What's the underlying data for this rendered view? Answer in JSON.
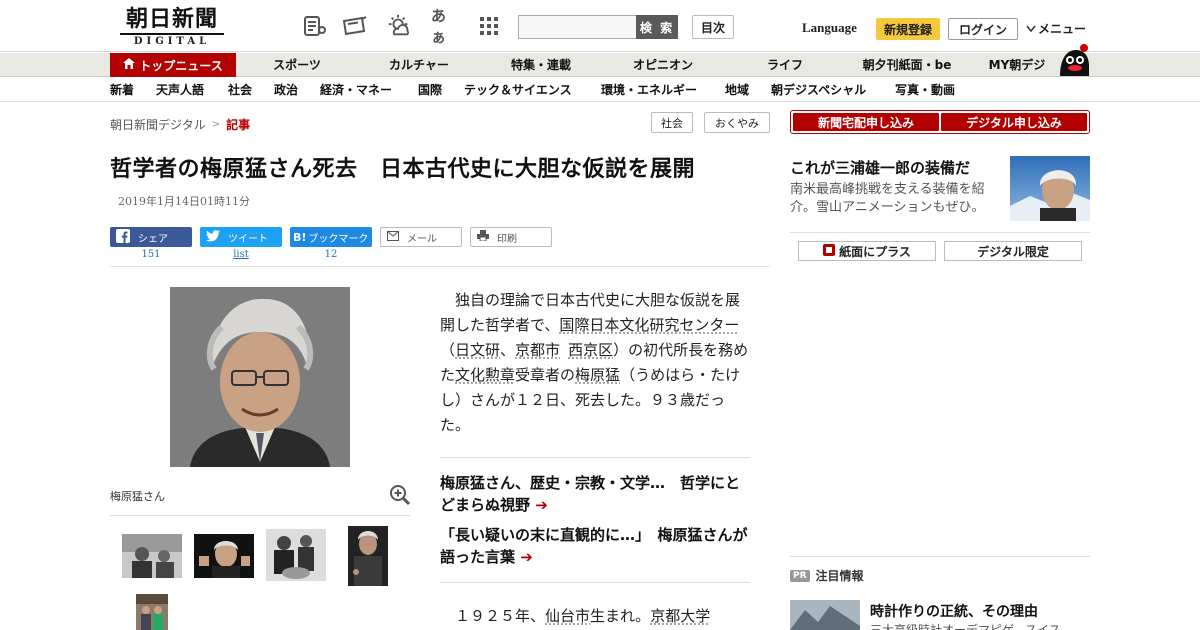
{
  "header": {
    "logo_text": "朝日新聞",
    "logo_sub": "DIGITAL",
    "search_button": "検 索",
    "toc_button": "目次",
    "language": "Language",
    "signup": "新規登録",
    "login": "ログイン",
    "menu": "メニュー",
    "font_size_icon_text": "あぁ"
  },
  "mainnav": {
    "top_news": "トップニュース",
    "items": [
      "スポーツ",
      "カルチャー",
      "特集・連載",
      "オピニオン",
      "ライフ",
      "朝夕刊紙面・be",
      "MY朝デジ"
    ]
  },
  "subnav": {
    "items": [
      "新着",
      "天声人語",
      "社会",
      "政治",
      "経済・マネー",
      "国際",
      "テック＆サイエンス",
      "環境・エネルギー",
      "地域",
      "朝デジスペシャル",
      "写真・動画"
    ]
  },
  "breadcrumb": {
    "home": "朝日新聞デジタル",
    "sep": ">",
    "current": "記事"
  },
  "tags": [
    "社会",
    "おくやみ"
  ],
  "article": {
    "title": "哲学者の梅原猛さん死去　日本古代史に大胆な仮説を展開",
    "date": "2019年1月14日01時11分",
    "photo_caption": "梅原猛さん",
    "body_parts": [
      {
        "t": "　独自の理論で日本古代史に大胆な仮説を展開した哲学者で、",
        "u": false
      },
      {
        "t": "国際日本文化研究センター",
        "u": true
      },
      {
        "t": "（",
        "u": false
      },
      {
        "t": "日文研",
        "u": true
      },
      {
        "t": "、",
        "u": false
      },
      {
        "t": "京都市",
        "u": true
      },
      {
        "t": "西京区",
        "u": true
      },
      {
        "t": "）の初代所長を務めた",
        "u": false
      },
      {
        "t": "文化勲章",
        "u": true
      },
      {
        "t": "受章者の",
        "u": false
      },
      {
        "t": "梅原猛",
        "u": true
      },
      {
        "t": "（うめはら・たけし）さんが１２日、死去した。９３歳だった。",
        "u": false
      }
    ],
    "related": [
      "梅原猛さん、歴史・宗教・文学…　哲学にとどまらぬ視野",
      "「長い疑いの末に直観的に…」　梅原猛さんが語った言葉"
    ],
    "body2_parts": [
      {
        "t": "　１９２５年、",
        "u": false
      },
      {
        "t": "仙台市",
        "u": true
      },
      {
        "t": "生まれ。",
        "u": false
      },
      {
        "t": "京都大学",
        "u": true
      }
    ]
  },
  "share": {
    "facebook": {
      "label": "シェア",
      "count": "151"
    },
    "twitter": {
      "label": "ツイート",
      "count": "list"
    },
    "hatena": {
      "label": "ブックマーク",
      "count": "12"
    },
    "mail": {
      "label": "メール"
    },
    "print": {
      "label": "印刷"
    }
  },
  "sidebar": {
    "subscribe_paper": "新聞宅配申し込み",
    "subscribe_digital": "デジタル申し込み",
    "promo_title": "これが三浦雄一郎の装備だ",
    "promo_desc": "南米最高峰挑戦を支える装備を紹介。雪山アニメーションもぜひ。",
    "btn_paper_plus": "紙面にプラス",
    "btn_digital_only": "デジタル限定",
    "pr_badge": "PR",
    "pr_label": "注目情報",
    "ad_title": "時計作りの正統、その理由",
    "ad_sub": "三大高級時計オーデマピゲ、スイス"
  },
  "colors": {
    "brand_red": "#b30000",
    "signup_yellow": "#f5c93c",
    "nav_bg": "#e9e8e3"
  }
}
